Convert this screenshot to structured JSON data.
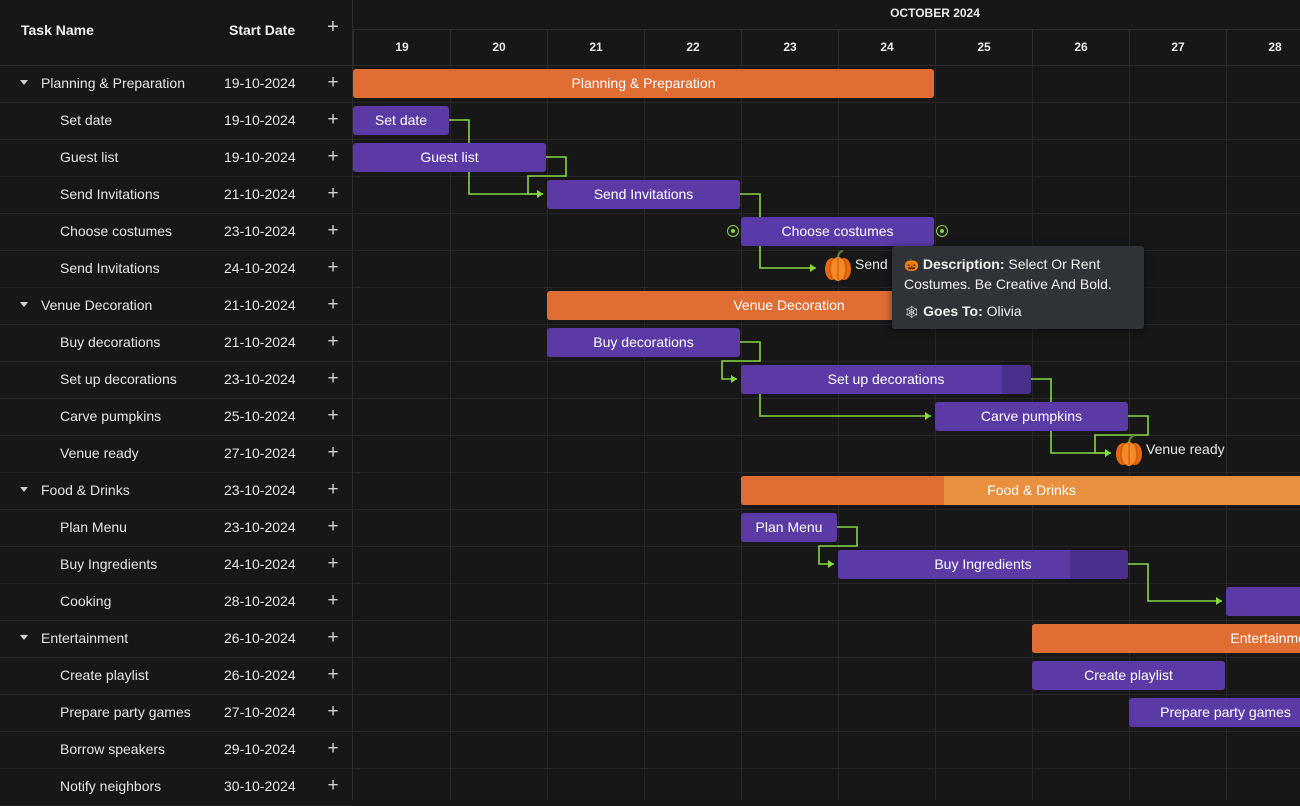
{
  "grid": {
    "col_task": "Task Name",
    "col_start": "Start Date",
    "add_glyph": "+",
    "rows": [
      {
        "name": "Planning & Preparation",
        "date": "19-10-2024",
        "level": 0
      },
      {
        "name": "Set date",
        "date": "19-10-2024",
        "level": 1
      },
      {
        "name": "Guest list",
        "date": "19-10-2024",
        "level": 1
      },
      {
        "name": "Send Invitations",
        "date": "21-10-2024",
        "level": 1
      },
      {
        "name": "Choose costumes",
        "date": "23-10-2024",
        "level": 1
      },
      {
        "name": "Send Invitations",
        "date": "24-10-2024",
        "level": 1
      },
      {
        "name": "Venue Decoration",
        "date": "21-10-2024",
        "level": 0
      },
      {
        "name": "Buy decorations",
        "date": "21-10-2024",
        "level": 1
      },
      {
        "name": "Set up decorations",
        "date": "23-10-2024",
        "level": 1
      },
      {
        "name": "Carve pumpkins",
        "date": "25-10-2024",
        "level": 1
      },
      {
        "name": "Venue ready",
        "date": "27-10-2024",
        "level": 1
      },
      {
        "name": "Food & Drinks",
        "date": "23-10-2024",
        "level": 0
      },
      {
        "name": "Plan Menu",
        "date": "23-10-2024",
        "level": 1
      },
      {
        "name": "Buy Ingredients",
        "date": "24-10-2024",
        "level": 1
      },
      {
        "name": "Cooking",
        "date": "28-10-2024",
        "level": 1
      },
      {
        "name": "Entertainment",
        "date": "26-10-2024",
        "level": 0
      },
      {
        "name": "Create playlist",
        "date": "26-10-2024",
        "level": 1
      },
      {
        "name": "Prepare party games",
        "date": "27-10-2024",
        "level": 1
      },
      {
        "name": "Borrow speakers",
        "date": "29-10-2024",
        "level": 1
      },
      {
        "name": "Notify neighbors",
        "date": "30-10-2024",
        "level": 1
      }
    ]
  },
  "timeline": {
    "month": "OCTOBER 2024",
    "days": [
      "19",
      "20",
      "21",
      "22",
      "23",
      "24",
      "25",
      "26",
      "27",
      "28"
    ],
    "first_day": 19
  },
  "bars": [
    {
      "row": 0,
      "label": "Planning & Preparation",
      "type": "project",
      "start": 19,
      "end": 25,
      "progress": 0
    },
    {
      "row": 1,
      "label": "Set date",
      "type": "task",
      "start": 19,
      "end": 20,
      "progress": 0
    },
    {
      "row": 2,
      "label": "Guest list",
      "type": "task",
      "start": 19,
      "end": 21,
      "progress": 0
    },
    {
      "row": 3,
      "label": "Send Invitations",
      "type": "task",
      "start": 21,
      "end": 23,
      "progress": 0
    },
    {
      "row": 4,
      "label": "Choose costumes",
      "type": "task",
      "start": 23,
      "end": 25,
      "progress": 0,
      "selected": true
    },
    {
      "row": 6,
      "label": "Venue Decoration",
      "type": "project",
      "start": 21,
      "end": 26,
      "progress": 0
    },
    {
      "row": 7,
      "label": "Buy decorations",
      "type": "task",
      "start": 21,
      "end": 23,
      "progress": 0
    },
    {
      "row": 8,
      "label": "Set up decorations",
      "type": "task",
      "start": 23,
      "end": 26,
      "progress": 0.9
    },
    {
      "row": 9,
      "label": "Carve pumpkins",
      "type": "task",
      "start": 25,
      "end": 27,
      "progress": 0
    },
    {
      "row": 11,
      "label": "Food & Drinks",
      "type": "project",
      "start": 23,
      "end": 29,
      "progress": 0.35
    },
    {
      "row": 12,
      "label": "Plan Menu",
      "type": "task",
      "start": 23,
      "end": 24,
      "progress": 0
    },
    {
      "row": 13,
      "label": "Buy Ingredients",
      "type": "task",
      "start": 24,
      "end": 27,
      "progress": 0.8
    },
    {
      "row": 14,
      "label": "",
      "type": "task",
      "start": 28,
      "end": 30,
      "progress": 0
    },
    {
      "row": 15,
      "label": "Entertainment",
      "type": "project",
      "start": 26,
      "end": 31,
      "progress": 0
    },
    {
      "row": 16,
      "label": "Create playlist",
      "type": "task",
      "start": 26,
      "end": 28,
      "progress": 0
    },
    {
      "row": 17,
      "label": "Prepare party games",
      "type": "task",
      "start": 27,
      "end": 29,
      "progress": 0
    }
  ],
  "milestones": [
    {
      "row": 5,
      "label": "Send I",
      "day": 24
    },
    {
      "row": 10,
      "label": "Venue ready",
      "day": 27
    }
  ],
  "tooltip": {
    "desc_label": "Description:",
    "desc_text_1": "Select Or Rent",
    "desc_text_2": "Costumes. Be Creative And Bold.",
    "goes_label": "Goes To:",
    "goes_value": "Olivia",
    "pumpkin_glyph": "🎃",
    "ghost_glyph": "🕸"
  },
  "colors": {
    "task": "#5b3aa6",
    "task_progress": "#4a2f8c",
    "task_selected": "#5a3aa8",
    "project": "#e06d33",
    "project_light": "#e8903f",
    "link": "#86d543"
  }
}
